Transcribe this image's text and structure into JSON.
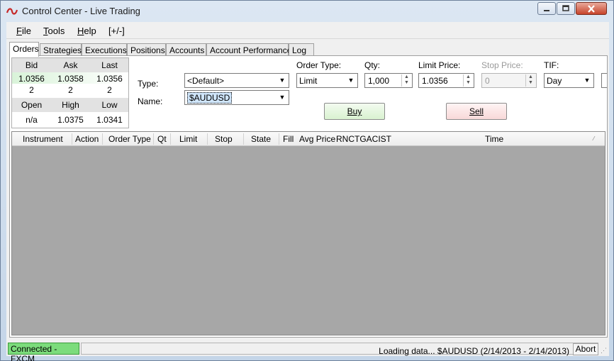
{
  "window": {
    "title": "Control Center - Live Trading"
  },
  "menu": [
    {
      "label": "File",
      "key": "F",
      "rest": "ile"
    },
    {
      "label": "Tools",
      "key": "T",
      "rest": "ools"
    },
    {
      "label": "Help",
      "key": "H",
      "rest": "elp"
    },
    {
      "label": "[+/-]"
    }
  ],
  "tabs": [
    {
      "label": "Orders",
      "active": true
    },
    {
      "label": "Strategies"
    },
    {
      "label": "Executions"
    },
    {
      "label": "Positions"
    },
    {
      "label": "Accounts"
    },
    {
      "label": "Account Performance"
    },
    {
      "label": "Log"
    }
  ],
  "quote": {
    "headers1": [
      "Bid",
      "Ask",
      "Last"
    ],
    "prices": [
      "1.0356",
      "1.0358",
      "1.0356"
    ],
    "sizes": [
      "2",
      "2",
      "2"
    ],
    "headers2": [
      "Open",
      "High",
      "Low"
    ],
    "values2": [
      "n/a",
      "1.0375",
      "1.0341"
    ]
  },
  "order_entry": {
    "type_label": "Type:",
    "type_value": "<Default>",
    "name_label": "Name:",
    "name_value": "$AUDUSD",
    "order_type_label": "Order Type:",
    "order_type_value": "Limit",
    "qty_label": "Qty:",
    "qty_value": "1,000",
    "limit_price_label": "Limit Price:",
    "limit_price_value": "1.0356",
    "stop_price_label": "Stop Price:",
    "stop_price_value": "0",
    "tif_label": "TIF:",
    "tif_value": "Day",
    "buy_label": "Buy",
    "sell_label": "Sell"
  },
  "grid": {
    "columns": [
      "Instrument",
      "Action",
      "Order Type",
      "Qt",
      "Limit",
      "Stop",
      "State",
      "Fill",
      "Avg Price",
      "RNCTGACIST",
      "Time"
    ]
  },
  "status": {
    "connection": "Connected - FXCM",
    "message": "Loading data... $AUDUSD  (2/14/2013 - 2/14/2013)",
    "abort_label": "Abort"
  },
  "colors": {
    "connected": "#7cdc7c",
    "buy": "#d9f2d0",
    "sell": "#f8d8d8",
    "grid_bg": "#a7a7a7"
  }
}
